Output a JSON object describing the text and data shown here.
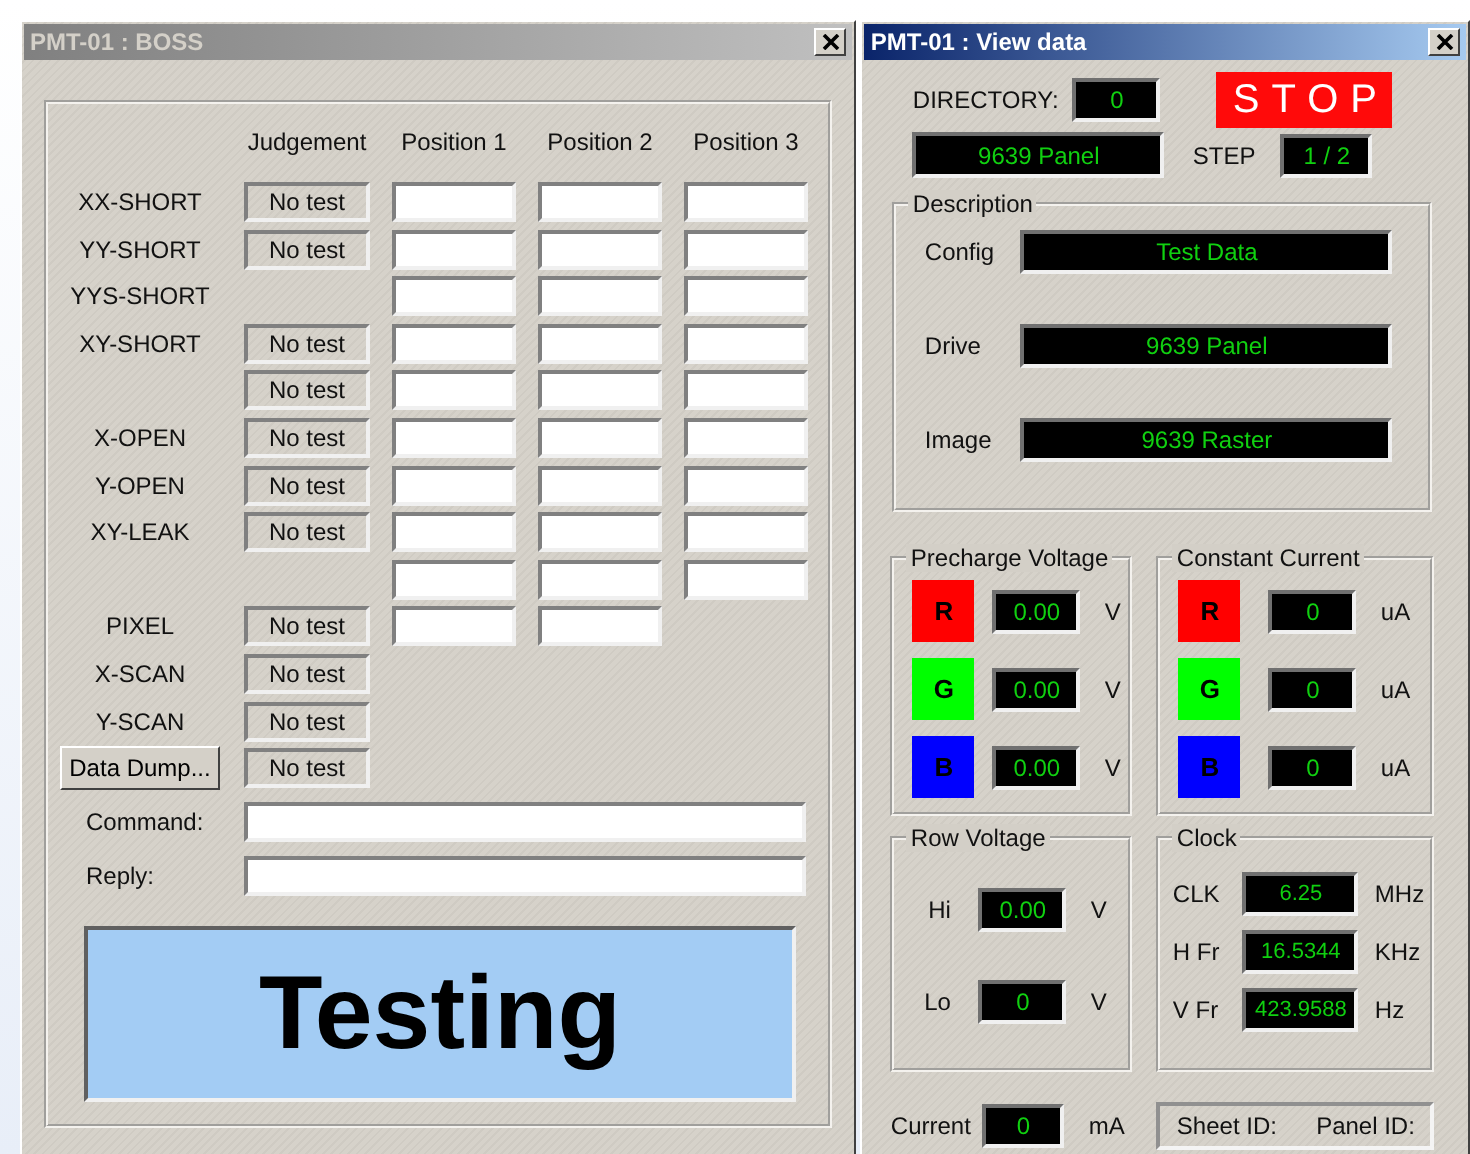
{
  "boss_window": {
    "title": "PMT-01 : BOSS",
    "active": false,
    "table": {
      "columns": [
        "Judgement",
        "Position 1",
        "Position 2",
        "Position 3"
      ],
      "rows": [
        {
          "kind": "full",
          "label": "XX-SHORT",
          "judgement": "No test"
        },
        {
          "kind": "full",
          "label": "YY-SHORT",
          "judgement": "No test"
        },
        {
          "kind": "full",
          "label": "YYS-SHORT"
        },
        {
          "kind": "full",
          "label": "XY-SHORT",
          "judgement": "No test"
        },
        {
          "kind": "full",
          "judgement": "No test"
        },
        {
          "kind": "full",
          "label": "X-OPEN",
          "judgement": "No test"
        },
        {
          "kind": "full",
          "label": "Y-OPEN",
          "judgement": "No test"
        },
        {
          "kind": "full",
          "label": "XY-LEAK",
          "judgement": "No test"
        },
        {
          "kind": "full"
        },
        {
          "kind": "partial",
          "label": "PIXEL",
          "judgement": "No test"
        },
        {
          "kind": "summary",
          "label": "X-SCAN",
          "judgement": "No test"
        },
        {
          "kind": "summary",
          "label": "Y-SCAN",
          "judgement": "No test"
        },
        {
          "kind": "button",
          "label": "Data Dump...",
          "judgement": "No test"
        }
      ]
    },
    "command": {
      "label": "Command:"
    },
    "reply": {
      "label": "Reply:"
    },
    "status": "Testing"
  },
  "view_window": {
    "title": "PMT-01 : View data",
    "active": true,
    "directory": {
      "label": "DIRECTORY:",
      "value": "0"
    },
    "stop_button": "STOP",
    "panel_name": "9639 Panel",
    "step": {
      "label": "STEP",
      "value": "1 / 2"
    },
    "description": {
      "title": "Description",
      "rows": [
        {
          "label": "Config",
          "value": "Test Data"
        },
        {
          "label": "Drive",
          "value": "9639 Panel"
        },
        {
          "label": "Image",
          "value": "9639 Raster"
        }
      ]
    },
    "precharge_voltage": {
      "title": "Precharge Voltage",
      "channels": [
        {
          "name": "R",
          "color": "#ff0000",
          "value": "0.00",
          "unit": "V"
        },
        {
          "name": "G",
          "color": "#00ff00",
          "value": "0.00",
          "unit": "V"
        },
        {
          "name": "B",
          "color": "#0000ff",
          "value": "0.00",
          "unit": "V"
        }
      ]
    },
    "constant_current": {
      "title": "Constant Current",
      "channels": [
        {
          "name": "R",
          "color": "#ff0000",
          "value": "0",
          "unit": "uA"
        },
        {
          "name": "G",
          "color": "#00ff00",
          "value": "0",
          "unit": "uA"
        },
        {
          "name": "B",
          "color": "#0000ff",
          "value": "0",
          "unit": "uA"
        }
      ]
    },
    "row_voltage": {
      "title": "Row Voltage",
      "rows": [
        {
          "label": "Hi",
          "value": "0.00",
          "unit": "V"
        },
        {
          "label": "Lo",
          "value": "0",
          "unit": "V"
        }
      ]
    },
    "clock": {
      "title": "Clock",
      "rows": [
        {
          "label": "CLK",
          "value": "6.25",
          "unit": "MHz"
        },
        {
          "label": "H Fr",
          "value": "16.5344",
          "unit": "KHz"
        },
        {
          "label": "V Fr",
          "value": "423.9588",
          "unit": "Hz"
        }
      ]
    },
    "current": {
      "label": "Current",
      "value": "0",
      "unit": "mA"
    },
    "ids": [
      "Sheet ID:",
      "Panel ID:"
    ]
  }
}
